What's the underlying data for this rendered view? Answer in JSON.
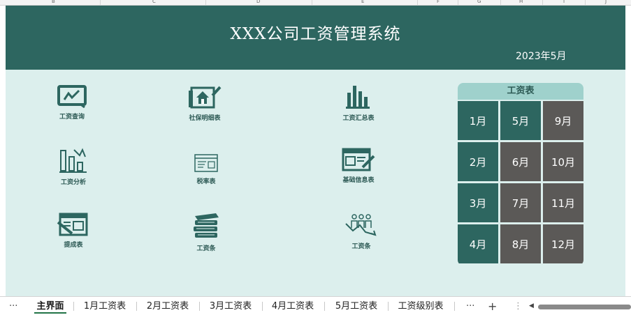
{
  "column_headers": [
    "B",
    "C",
    "D",
    "E",
    "F",
    "G",
    "H",
    "I",
    "J"
  ],
  "title": "XXX公司工资管理系统",
  "date": "2023年5月",
  "menu": {
    "query": "工资查询",
    "social": "社保明细表",
    "summary": "工资汇总表",
    "analysis": "工资分析",
    "tax": "税率表",
    "basic": "基础信息表",
    "commission": "提成表",
    "slip": "工资条",
    "slip2": "工资条"
  },
  "panel": {
    "title": "工资表",
    "months": [
      "1月",
      "5月",
      "9月",
      "2月",
      "6月",
      "10月",
      "3月",
      "7月",
      "11月",
      "4月",
      "8月",
      "12月"
    ]
  },
  "tabs": {
    "more_left": "···",
    "items": [
      "主界面",
      "1月工资表",
      "2月工资表",
      "3月工资表",
      "4月工资表",
      "5月工资表",
      "工资级别表"
    ],
    "more_right": "···",
    "add": "+",
    "dots": "⋮",
    "left_arrow": "◀"
  },
  "colors": {
    "banner": "#2d6660",
    "sheet_bg": "#dcefed",
    "panel_header": "#9fd1cc",
    "cell_green": "#2d6660",
    "cell_gray": "#5b5957",
    "active_tab_underline": "#217346"
  }
}
